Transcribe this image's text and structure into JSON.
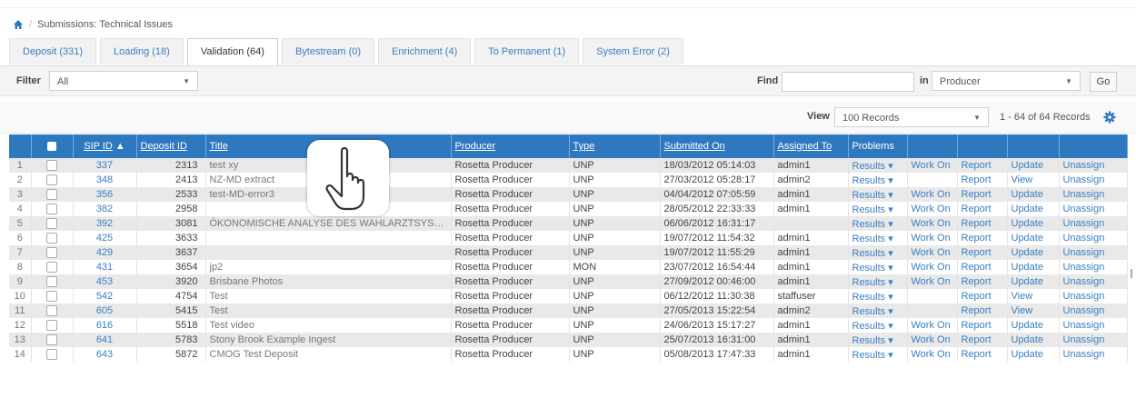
{
  "breadcrumb": {
    "title": "Submissions: Technical Issues"
  },
  "tabs": [
    {
      "label": "Deposit (331)"
    },
    {
      "label": "Loading (18)"
    },
    {
      "label": "Validation (64)",
      "active": true
    },
    {
      "label": "Bytestream (0)"
    },
    {
      "label": "Enrichment (4)"
    },
    {
      "label": "To Permanent (1)"
    },
    {
      "label": "System Error (2)"
    }
  ],
  "filter": {
    "label": "Filter",
    "value": "All"
  },
  "find": {
    "label": "Find",
    "value": "",
    "in_label": "in",
    "field_value": "Producer",
    "go_label": "Go"
  },
  "view": {
    "label": "View",
    "value": "100 Records",
    "record_count": "1 - 64 of 64 Records"
  },
  "columns": [
    "SIP ID",
    "Deposit ID",
    "Title",
    "Producer",
    "Type",
    "Submitted On",
    "Assigned To",
    "Problems"
  ],
  "rows": [
    {
      "n": "1",
      "sip": "337",
      "dep": "2313",
      "title": "test xy",
      "producer": "Rosetta Producer",
      "type": "UNP",
      "submitted": "18/03/2012 05:14:03",
      "assigned": "admin1",
      "results": "Results ▾",
      "workon": "Work On",
      "report": "Report",
      "update": "Update",
      "unassign": "Unassign"
    },
    {
      "n": "2",
      "sip": "348",
      "dep": "2413",
      "title": "NZ-MD extract",
      "producer": "Rosetta Producer",
      "type": "UNP",
      "submitted": "27/03/2012 05:28:17",
      "assigned": "admin2",
      "results": "Results ▾",
      "workon": "",
      "report": "Report",
      "update": "View",
      "unassign": "Unassign"
    },
    {
      "n": "3",
      "sip": "356",
      "dep": "2533",
      "title": "test-MD-error3",
      "producer": "Rosetta Producer",
      "type": "UNP",
      "submitted": "04/04/2012 07:05:59",
      "assigned": "admin1",
      "results": "Results ▾",
      "workon": "Work On",
      "report": "Report",
      "update": "Update",
      "unassign": "Unassign"
    },
    {
      "n": "4",
      "sip": "382",
      "dep": "2958",
      "title": "",
      "producer": "Rosetta Producer",
      "type": "UNP",
      "submitted": "28/05/2012 22:33:33",
      "assigned": "admin1",
      "results": "Results ▾",
      "workon": "Work On",
      "report": "Report",
      "update": "Update",
      "unassign": "Unassign"
    },
    {
      "n": "5",
      "sip": "392",
      "dep": "3081",
      "title": "ÖKONOMISCHE ANALYSE DES WAHLARZTSYSTEMS ...",
      "producer": "Rosetta Producer",
      "type": "UNP",
      "submitted": "06/06/2012 16:31:17",
      "assigned": "",
      "results": "Results ▾",
      "workon": "Work On",
      "report": "Report",
      "update": "Update",
      "unassign": "Unassign"
    },
    {
      "n": "6",
      "sip": "425",
      "dep": "3633",
      "title": "",
      "producer": "Rosetta Producer",
      "type": "UNP",
      "submitted": "19/07/2012 11:54:32",
      "assigned": "admin1",
      "results": "Results ▾",
      "workon": "Work On",
      "report": "Report",
      "update": "Update",
      "unassign": "Unassign"
    },
    {
      "n": "7",
      "sip": "429",
      "dep": "3637",
      "title": "",
      "producer": "Rosetta Producer",
      "type": "UNP",
      "submitted": "19/07/2012 11:55:29",
      "assigned": "admin1",
      "results": "Results ▾",
      "workon": "Work On",
      "report": "Report",
      "update": "Update",
      "unassign": "Unassign"
    },
    {
      "n": "8",
      "sip": "431",
      "dep": "3654",
      "title": "jp2",
      "producer": "Rosetta Producer",
      "type": "MON",
      "submitted": "23/07/2012 16:54:44",
      "assigned": "admin1",
      "results": "Results ▾",
      "workon": "Work On",
      "report": "Report",
      "update": "Update",
      "unassign": "Unassign"
    },
    {
      "n": "9",
      "sip": "453",
      "dep": "3920",
      "title": "Brisbane Photos",
      "producer": "Rosetta Producer",
      "type": "UNP",
      "submitted": "27/09/2012 00:46:00",
      "assigned": "admin1",
      "results": "Results ▾",
      "workon": "Work On",
      "report": "Report",
      "update": "Update",
      "unassign": "Unassign"
    },
    {
      "n": "10",
      "sip": "542",
      "dep": "4754",
      "title": "Test",
      "producer": "Rosetta Producer",
      "type": "UNP",
      "submitted": "06/12/2012 11:30:38",
      "assigned": "staffuser",
      "results": "Results ▾",
      "workon": "",
      "report": "Report",
      "update": "View",
      "unassign": "Unassign"
    },
    {
      "n": "11",
      "sip": "605",
      "dep": "5415",
      "title": "Test",
      "producer": "Rosetta Producer",
      "type": "UNP",
      "submitted": "27/05/2013 15:22:54",
      "assigned": "admin2",
      "results": "Results ▾",
      "workon": "",
      "report": "Report",
      "update": "View",
      "unassign": "Unassign"
    },
    {
      "n": "12",
      "sip": "616",
      "dep": "5518",
      "title": "Test video",
      "producer": "Rosetta Producer",
      "type": "UNP",
      "submitted": "24/06/2013 15:17:27",
      "assigned": "admin1",
      "results": "Results ▾",
      "workon": "Work On",
      "report": "Report",
      "update": "Update",
      "unassign": "Unassign"
    },
    {
      "n": "13",
      "sip": "641",
      "dep": "5783",
      "title": "Stony Brook Example Ingest",
      "producer": "Rosetta Producer",
      "type": "UNP",
      "submitted": "25/07/2013 16:31:00",
      "assigned": "admin1",
      "results": "Results ▾",
      "workon": "Work On",
      "report": "Report",
      "update": "Update",
      "unassign": "Unassign"
    },
    {
      "n": "14",
      "sip": "643",
      "dep": "5872",
      "title": "CMOG Test Deposit",
      "producer": "Rosetta Producer",
      "type": "UNP",
      "submitted": "05/08/2013 17:47:33",
      "assigned": "admin1",
      "results": "Results ▾",
      "workon": "Work On",
      "report": "Report",
      "update": "Update",
      "unassign": "Unassign"
    }
  ],
  "colors": {
    "header": "#2e78c0",
    "link": "#3a7fc1"
  },
  "icons": {
    "home": "home-icon",
    "gear": "gear-icon",
    "hand": "hand-pointer-icon"
  }
}
